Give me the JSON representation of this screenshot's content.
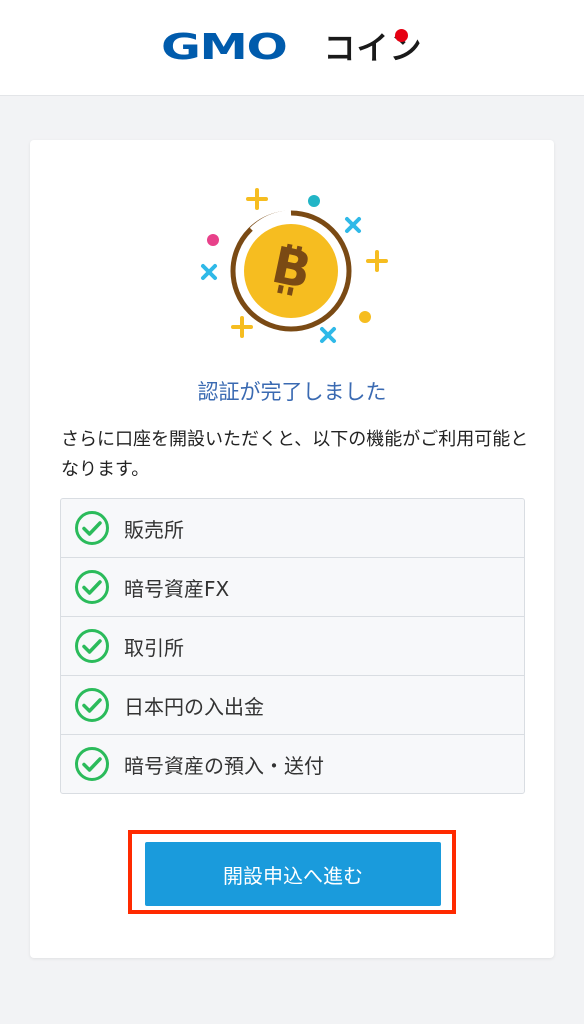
{
  "header": {
    "logo_text": "GMO",
    "logo_suffix": "コイン"
  },
  "card": {
    "title": "認証が完了しました",
    "description": "さらに口座を開設いただくと、以下の機能がご利用可能となります。",
    "features": [
      {
        "label": "販売所"
      },
      {
        "label": "暗号資産FX"
      },
      {
        "label": "取引所"
      },
      {
        "label": "日本円の入出金"
      },
      {
        "label": "暗号資産の預入・送付"
      }
    ],
    "cta_label": "開設申込へ進む"
  },
  "colors": {
    "brand_blue": "#005bac",
    "title_blue": "#3a6ab2",
    "button_blue": "#1a9bdc",
    "check_green": "#2bbb5b",
    "coin_yellow": "#f6bd20",
    "highlight_red": "#ff2a00"
  }
}
